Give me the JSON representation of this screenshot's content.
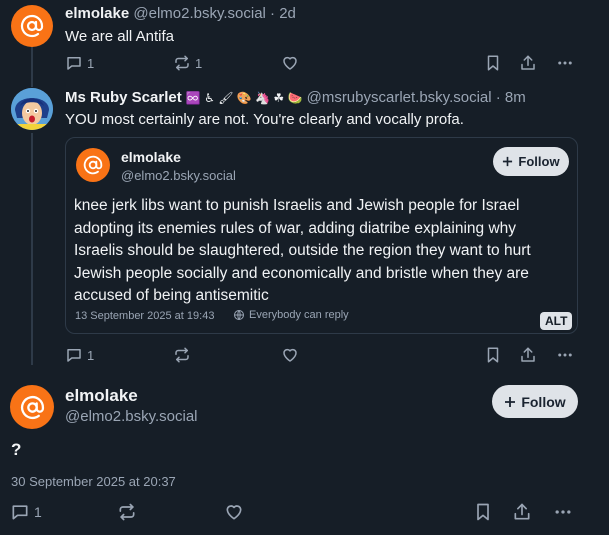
{
  "post1": {
    "author_name": "elmolake",
    "handle_time": "@elmo2.bsky.social · 2d",
    "text": "We are all Antifa",
    "reply_count": "1",
    "repost_count": "1"
  },
  "post2": {
    "author_name": "Ms Ruby Scarlet",
    "emojis": "♾️ ♿ 🖌 🎨 🦄 ☘ 🍉",
    "handle_time": "@msrubyscarlet.bsky.social · 8m",
    "text": "YOU most certainly are not. You're clearly and vocally profa.",
    "reply_count": "1",
    "quote": {
      "author_name": "elmolake",
      "handle": "@elmo2.bsky.social",
      "follow_label": "Follow",
      "text": "knee jerk libs want to punish Israelis and Jewish people for Israel adopting its enemies rules of war, adding diatribe explaining why Israelis should be slaughtered, outside the region they want to hurt Jewish people socially and economically and bristle when they are accused of being antisemitic",
      "timestamp": "13 September 2025 at 19:43",
      "reply_setting": "Everybody can reply",
      "alt_label": "ALT"
    }
  },
  "post3": {
    "author_name": "elmolake",
    "handle": "@elmo2.bsky.social",
    "follow_label": "Follow",
    "text": "?",
    "timestamp": "30 September 2025 at 20:37",
    "reply_count": "1"
  },
  "colors": {
    "background": "#161e27",
    "avatar_orange": "#f97316",
    "muted_text": "#9aa5b4",
    "border": "#2e3a48"
  }
}
